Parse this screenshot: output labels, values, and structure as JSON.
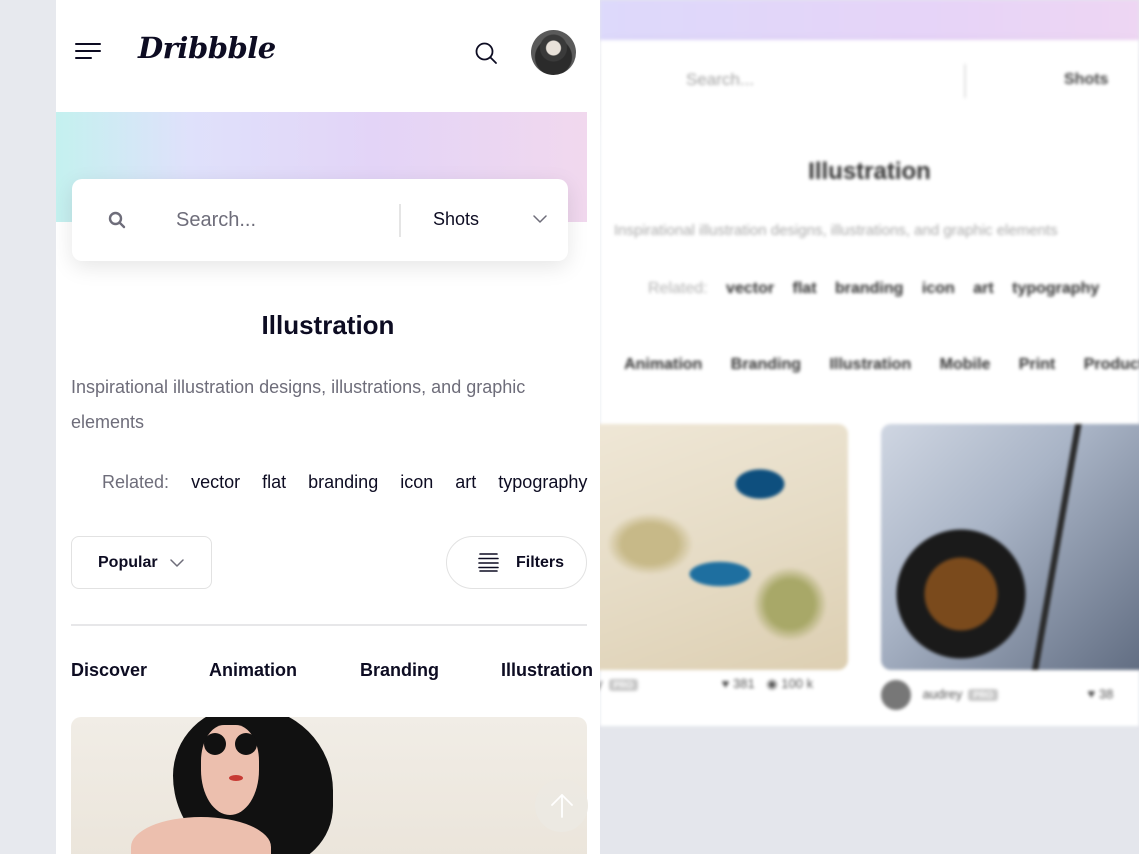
{
  "header": {
    "logo": "Dribbble",
    "menu_icon": "hamburger-menu-icon",
    "search_icon": "search-icon",
    "avatar": "user-avatar"
  },
  "search": {
    "placeholder": "Search...",
    "type_selected": "Shots"
  },
  "page": {
    "title": "Illustration",
    "description": "Inspirational illustration designs, illustrations, and graphic elements"
  },
  "related": {
    "label": "Related:",
    "tags": [
      "vector",
      "flat",
      "branding",
      "icon",
      "art",
      "typography"
    ]
  },
  "sort": {
    "label": "Popular"
  },
  "filters": {
    "label": "Filters"
  },
  "categories": [
    "Discover",
    "Animation",
    "Branding",
    "Illustration"
  ],
  "background_page": {
    "search_placeholder": "Search...",
    "type_selected": "Shots",
    "title": "Illustration",
    "description": "Inspirational illustration designs, illustrations, and graphic elements",
    "related_label": "Related:",
    "related_tags": [
      "vector",
      "flat",
      "branding",
      "icon",
      "art",
      "typography"
    ],
    "categories": [
      "r",
      "Animation",
      "Branding",
      "Illustration",
      "Mobile",
      "Print",
      "Product D"
    ],
    "shots": [
      {
        "author": "y",
        "badge": "PRO",
        "likes": "381",
        "views": "100 k"
      },
      {
        "author": "audrey",
        "badge": "PRO",
        "likes": "38"
      }
    ]
  },
  "colors": {
    "text": "#0d0c22",
    "muted": "#6e6d7a",
    "border": "#e2e2e2"
  }
}
